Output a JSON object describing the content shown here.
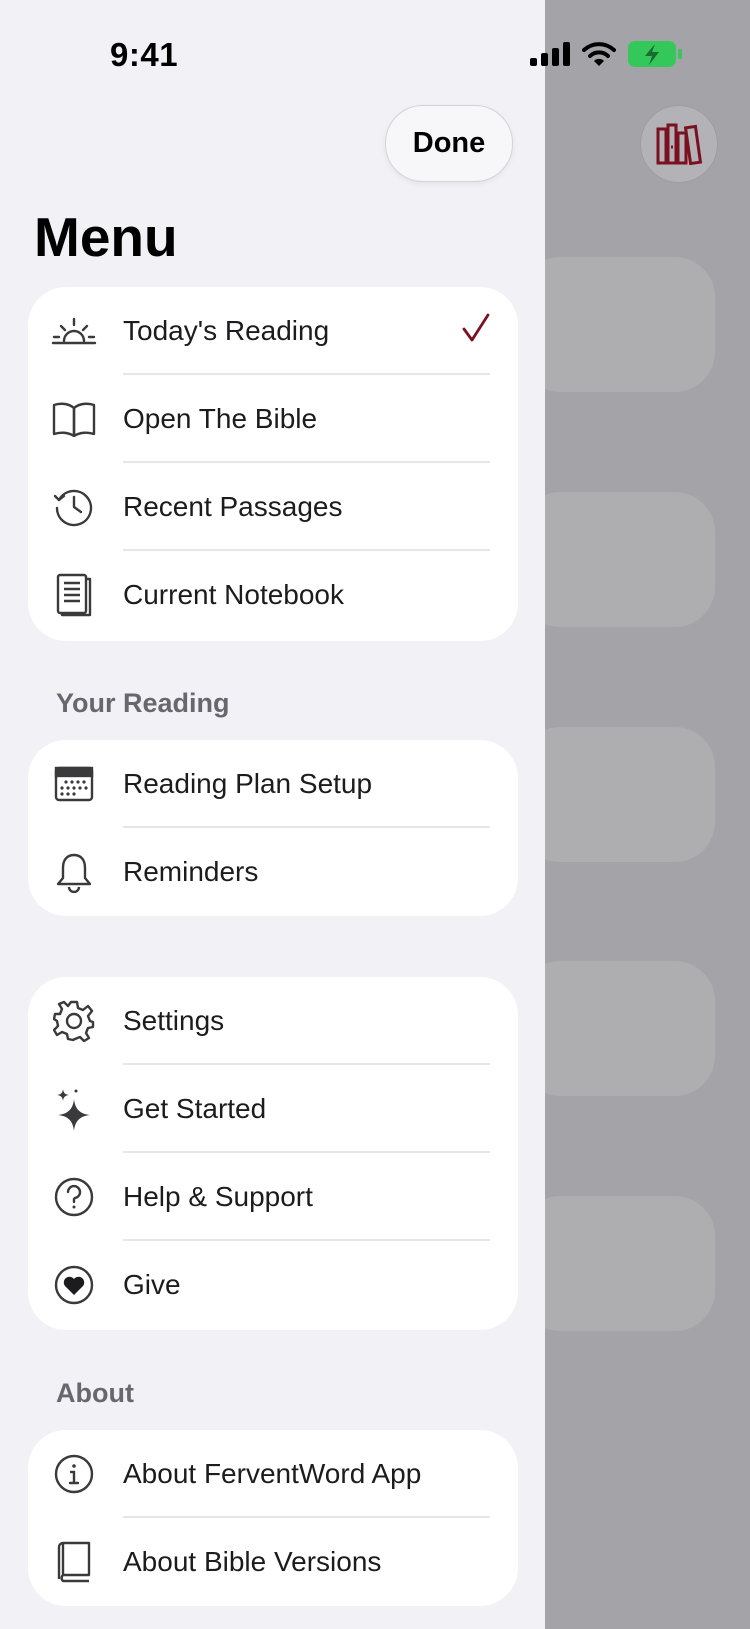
{
  "status": {
    "time": "9:41"
  },
  "header": {
    "done_label": "Done",
    "title": "Menu"
  },
  "colors": {
    "accent": "#7a1020",
    "battery": "#34c759"
  },
  "groups": {
    "main": [
      {
        "label": "Today's Reading",
        "icon": "sunrise-icon",
        "selected": true
      },
      {
        "label": "Open The Bible",
        "icon": "book-open-icon"
      },
      {
        "label": "Recent Passages",
        "icon": "history-icon"
      },
      {
        "label": "Current Notebook",
        "icon": "notebook-icon"
      }
    ],
    "reading_header": "Your Reading",
    "reading": [
      {
        "label": "Reading Plan Setup",
        "icon": "calendar-icon"
      },
      {
        "label": "Reminders",
        "icon": "bell-icon"
      }
    ],
    "support": [
      {
        "label": "Settings",
        "icon": "gear-icon"
      },
      {
        "label": "Get Started",
        "icon": "sparkle-icon"
      },
      {
        "label": "Help & Support",
        "icon": "question-circle-icon"
      },
      {
        "label": "Give",
        "icon": "heart-circle-icon"
      }
    ],
    "about_header": "About",
    "about": [
      {
        "label": "About FerventWord App",
        "icon": "info-circle-icon"
      },
      {
        "label": "About Bible Versions",
        "icon": "book-closed-icon"
      }
    ]
  },
  "background": {
    "library_icon": "library-books-icon"
  }
}
